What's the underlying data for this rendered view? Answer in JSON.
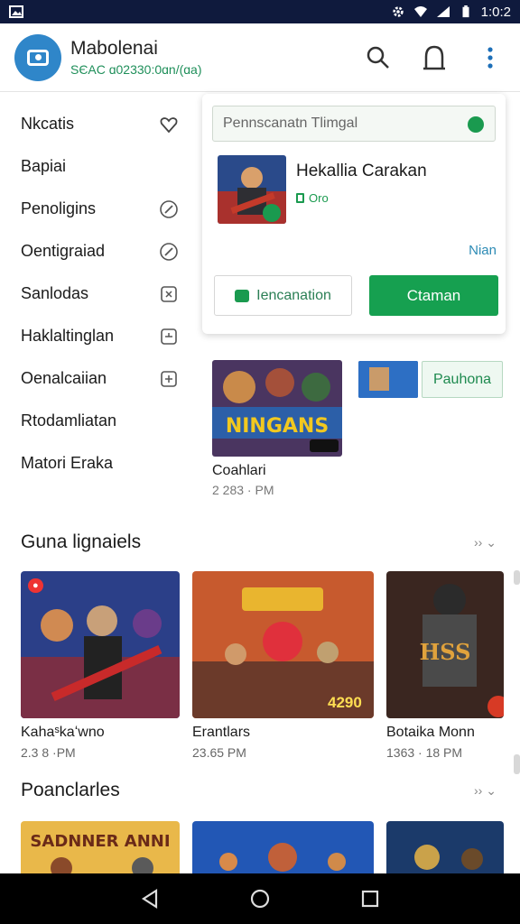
{
  "status_bar": {
    "time": "1:0:2",
    "icons": [
      "image-icon",
      "gear-icon",
      "wifi-icon",
      "signal-icon",
      "battery-icon"
    ]
  },
  "app_bar": {
    "title": "Mabolenai",
    "subtitle": "SЄAC ɑ02330:0ɑn/(ɑa)"
  },
  "sidebar": {
    "items": [
      {
        "label": "Nkcatis",
        "icon": "heart-icon",
        "bold": true
      },
      {
        "label": "Bapiai",
        "icon": "",
        "bold": false
      },
      {
        "label": "Penoligins",
        "icon": "compass-icon",
        "bold": false
      },
      {
        "label": "Oentigraiad",
        "icon": "compass-icon",
        "bold": false
      },
      {
        "label": "Sanlodas",
        "icon": "crop-icon",
        "bold": false
      },
      {
        "label": "Haklaltinglan",
        "icon": "crop-icon",
        "bold": false
      },
      {
        "label": "Oenalcaiian",
        "icon": "crop-icon",
        "bold": false
      },
      {
        "label": "Rtodamliatan",
        "icon": "",
        "bold": false
      },
      {
        "label": "Matori Eraka",
        "icon": "",
        "bold": false
      }
    ]
  },
  "panel": {
    "search_placeholder": "Pennscanatn Tlimgal",
    "game_title": "Hekallia Carakan",
    "game_meta": "Oro",
    "more_link": "Nian",
    "secondary_button": "Iencanation",
    "primary_button": "Ctaman"
  },
  "feature": {
    "title": "Coahlari",
    "time": "2 283 · PM",
    "side_button": "Pauhona",
    "art_text": "NINGANS"
  },
  "sections": [
    {
      "title": "Guna lignaiels",
      "more": "›› ⌄",
      "cards": [
        {
          "title": "Kahaˢkaʻwno",
          "time": "2.3  8 ·PM",
          "badge": "🔴",
          "price": ""
        },
        {
          "title": "Erantlars",
          "time": "23.65  PM",
          "badge": "✧",
          "price": "4290"
        },
        {
          "title": "Botaika Monn",
          "time": "1363 · 18 PM",
          "badge": "",
          "price": ""
        }
      ]
    },
    {
      "title": "Poanclarles",
      "more": "›› ⌄",
      "cards": [
        {
          "title": "",
          "time": "",
          "art_text": "SADNNER ANNI"
        },
        {
          "title": "",
          "time": "",
          "art_text": ""
        },
        {
          "title": "",
          "time": "",
          "art_text": ""
        }
      ]
    }
  ],
  "colors": {
    "accent": "#16a050",
    "status_bar": "#0f1a3d",
    "logo": "#2f86c9",
    "link": "#2d8bb5"
  }
}
